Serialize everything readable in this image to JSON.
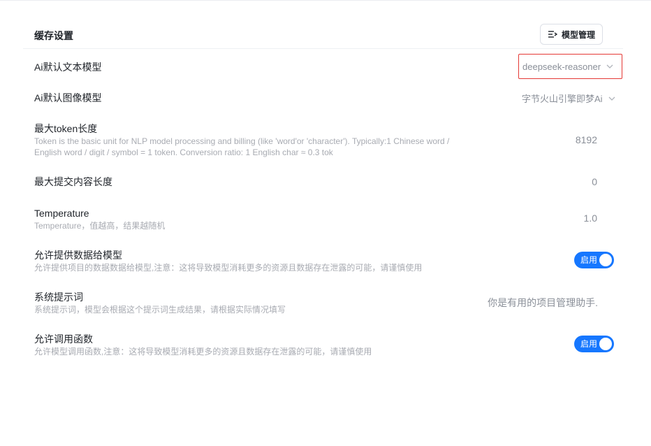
{
  "header": {
    "title": "缓存设置",
    "model_button_label": "模型管理",
    "model_button_icon": "list-arrow-icon"
  },
  "settings": {
    "text_model": {
      "label": "Ai默认文本模型",
      "value": "deepseek-reasoner"
    },
    "image_model": {
      "label": "Ai默认图像模型",
      "value": "字节火山引擎即梦Ai"
    },
    "max_token": {
      "label": "最大token长度",
      "description_line1": "Token is the basic unit for NLP model processing and billing (like 'word'or 'character'). Typically:1 Chinese word /",
      "description_line2": "English word / digit / symbol = 1 token. Conversion ratio: 1 English char ≈ 0.3 tok",
      "value": "8192"
    },
    "max_submit": {
      "label": "最大提交内容长度",
      "value": "0"
    },
    "temperature": {
      "label": "Temperature",
      "description": "Temperature，值越高，结果越随机",
      "value": "1.0"
    },
    "allow_data": {
      "label": "允许提供数据给模型",
      "description": "允许提供项目的数据数据给模型,注意：这将导致模型消耗更多的资源且数据存在泄露的可能，请谨慎使用",
      "toggle_label": "启用",
      "enabled": true
    },
    "system_prompt": {
      "label": "系统提示词",
      "description": "系统提示词，模型会根据这个提示词生成结果，请根据实际情况填写",
      "value": "你是有用的项目管理助手."
    },
    "allow_functions": {
      "label": "允许调用函数",
      "description": "允许模型调用函数,注意：这将导致模型消耗更多的资源且数据存在泄露的可能，请谨慎使用",
      "toggle_label": "启用",
      "enabled": true
    }
  },
  "colors": {
    "accent": "#1677ff",
    "highlight_border": "#e53935"
  }
}
